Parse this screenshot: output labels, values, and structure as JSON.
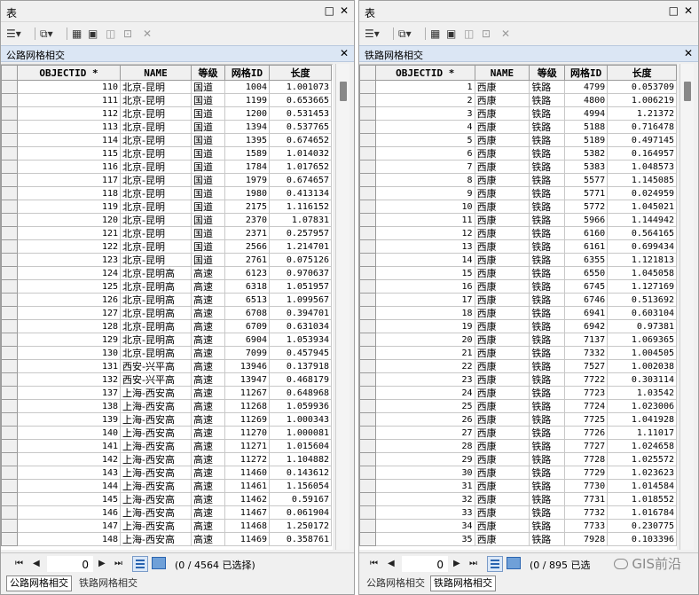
{
  "left": {
    "window_title": "表",
    "table_tab": "公路网格相交",
    "columns": [
      "OBJECTID *",
      "NAME",
      "等级",
      "网格ID",
      "长度"
    ],
    "rows": [
      [
        "110",
        "北京-昆明",
        "国道",
        "1004",
        "1.001073"
      ],
      [
        "111",
        "北京-昆明",
        "国道",
        "1199",
        "0.653665"
      ],
      [
        "112",
        "北京-昆明",
        "国道",
        "1200",
        "0.531453"
      ],
      [
        "113",
        "北京-昆明",
        "国道",
        "1394",
        "0.537765"
      ],
      [
        "114",
        "北京-昆明",
        "国道",
        "1395",
        "0.674652"
      ],
      [
        "115",
        "北京-昆明",
        "国道",
        "1589",
        "1.014032"
      ],
      [
        "116",
        "北京-昆明",
        "国道",
        "1784",
        "1.017652"
      ],
      [
        "117",
        "北京-昆明",
        "国道",
        "1979",
        "0.674657"
      ],
      [
        "118",
        "北京-昆明",
        "国道",
        "1980",
        "0.413134"
      ],
      [
        "119",
        "北京-昆明",
        "国道",
        "2175",
        "1.116152"
      ],
      [
        "120",
        "北京-昆明",
        "国道",
        "2370",
        "1.07831"
      ],
      [
        "121",
        "北京-昆明",
        "国道",
        "2371",
        "0.257957"
      ],
      [
        "122",
        "北京-昆明",
        "国道",
        "2566",
        "1.214701"
      ],
      [
        "123",
        "北京-昆明",
        "国道",
        "2761",
        "0.075126"
      ],
      [
        "124",
        "北京-昆明高",
        "高速",
        "6123",
        "0.970637"
      ],
      [
        "125",
        "北京-昆明高",
        "高速",
        "6318",
        "1.051957"
      ],
      [
        "126",
        "北京-昆明高",
        "高速",
        "6513",
        "1.099567"
      ],
      [
        "127",
        "北京-昆明高",
        "高速",
        "6708",
        "0.394701"
      ],
      [
        "128",
        "北京-昆明高",
        "高速",
        "6709",
        "0.631034"
      ],
      [
        "129",
        "北京-昆明高",
        "高速",
        "6904",
        "1.053934"
      ],
      [
        "130",
        "北京-昆明高",
        "高速",
        "7099",
        "0.457945"
      ],
      [
        "131",
        "西安-兴平高",
        "高速",
        "13946",
        "0.137918"
      ],
      [
        "132",
        "西安-兴平高",
        "高速",
        "13947",
        "0.468179"
      ],
      [
        "137",
        "上海-西安高",
        "高速",
        "11267",
        "0.648968"
      ],
      [
        "138",
        "上海-西安高",
        "高速",
        "11268",
        "1.059936"
      ],
      [
        "139",
        "上海-西安高",
        "高速",
        "11269",
        "1.000343"
      ],
      [
        "140",
        "上海-西安高",
        "高速",
        "11270",
        "1.000081"
      ],
      [
        "141",
        "上海-西安高",
        "高速",
        "11271",
        "1.015604"
      ],
      [
        "142",
        "上海-西安高",
        "高速",
        "11272",
        "1.104882"
      ],
      [
        "143",
        "上海-西安高",
        "高速",
        "11460",
        "0.143612"
      ],
      [
        "144",
        "上海-西安高",
        "高速",
        "11461",
        "1.156054"
      ],
      [
        "145",
        "上海-西安高",
        "高速",
        "11462",
        "0.59167"
      ],
      [
        "146",
        "上海-西安高",
        "高速",
        "11467",
        "0.061904"
      ],
      [
        "147",
        "上海-西安高",
        "高速",
        "11468",
        "1.250172"
      ],
      [
        "148",
        "上海-西安高",
        "高速",
        "11469",
        "0.358761"
      ]
    ],
    "record_value": "0",
    "selection_text": "(0 / 4564 已选择)",
    "bottom_tabs": [
      "公路网格相交",
      "铁路网格相交"
    ]
  },
  "right": {
    "window_title": "表",
    "table_tab": "铁路网格相交",
    "columns": [
      "OBJECTID *",
      "NAME",
      "等级",
      "网格ID",
      "长度"
    ],
    "rows": [
      [
        "1",
        "西康",
        "铁路",
        "4799",
        "0.053709"
      ],
      [
        "2",
        "西康",
        "铁路",
        "4800",
        "1.006219"
      ],
      [
        "3",
        "西康",
        "铁路",
        "4994",
        "1.21372"
      ],
      [
        "4",
        "西康",
        "铁路",
        "5188",
        "0.716478"
      ],
      [
        "5",
        "西康",
        "铁路",
        "5189",
        "0.497145"
      ],
      [
        "6",
        "西康",
        "铁路",
        "5382",
        "0.164957"
      ],
      [
        "7",
        "西康",
        "铁路",
        "5383",
        "1.048573"
      ],
      [
        "8",
        "西康",
        "铁路",
        "5577",
        "1.145085"
      ],
      [
        "9",
        "西康",
        "铁路",
        "5771",
        "0.024959"
      ],
      [
        "10",
        "西康",
        "铁路",
        "5772",
        "1.045021"
      ],
      [
        "11",
        "西康",
        "铁路",
        "5966",
        "1.144942"
      ],
      [
        "12",
        "西康",
        "铁路",
        "6160",
        "0.564165"
      ],
      [
        "13",
        "西康",
        "铁路",
        "6161",
        "0.699434"
      ],
      [
        "14",
        "西康",
        "铁路",
        "6355",
        "1.121813"
      ],
      [
        "15",
        "西康",
        "铁路",
        "6550",
        "1.045058"
      ],
      [
        "16",
        "西康",
        "铁路",
        "6745",
        "1.127169"
      ],
      [
        "17",
        "西康",
        "铁路",
        "6746",
        "0.513692"
      ],
      [
        "18",
        "西康",
        "铁路",
        "6941",
        "0.603104"
      ],
      [
        "19",
        "西康",
        "铁路",
        "6942",
        "0.97381"
      ],
      [
        "20",
        "西康",
        "铁路",
        "7137",
        "1.069365"
      ],
      [
        "21",
        "西康",
        "铁路",
        "7332",
        "1.004505"
      ],
      [
        "22",
        "西康",
        "铁路",
        "7527",
        "1.002038"
      ],
      [
        "23",
        "西康",
        "铁路",
        "7722",
        "0.303114"
      ],
      [
        "24",
        "西康",
        "铁路",
        "7723",
        "1.03542"
      ],
      [
        "25",
        "西康",
        "铁路",
        "7724",
        "1.023006"
      ],
      [
        "26",
        "西康",
        "铁路",
        "7725",
        "1.041928"
      ],
      [
        "27",
        "西康",
        "铁路",
        "7726",
        "1.11017"
      ],
      [
        "28",
        "西康",
        "铁路",
        "7727",
        "1.024658"
      ],
      [
        "29",
        "西康",
        "铁路",
        "7728",
        "1.025572"
      ],
      [
        "30",
        "西康",
        "铁路",
        "7729",
        "1.023623"
      ],
      [
        "31",
        "西康",
        "铁路",
        "7730",
        "1.014584"
      ],
      [
        "32",
        "西康",
        "铁路",
        "7731",
        "1.018552"
      ],
      [
        "33",
        "西康",
        "铁路",
        "7732",
        "1.016784"
      ],
      [
        "34",
        "西康",
        "铁路",
        "7733",
        "0.230775"
      ],
      [
        "35",
        "西康",
        "铁路",
        "7928",
        "0.103396"
      ]
    ],
    "record_value": "0",
    "selection_text": "(0 / 895 已选",
    "bottom_tabs": [
      "公路网格相交",
      "铁路网格相交"
    ]
  },
  "icons": {
    "close": "close-icon",
    "restore": "restore-icon",
    "table-options": "table-options-icon",
    "related-tables": "related-tables-icon",
    "select-by-attributes": "select-by-attributes-icon",
    "switch-selection": "switch-selection-icon",
    "clear-selection": "clear-selection-icon",
    "zoom-to-selected": "zoom-to-selected-icon",
    "delete-selected": "delete-selected-icon"
  },
  "watermark": "GIS前沿"
}
